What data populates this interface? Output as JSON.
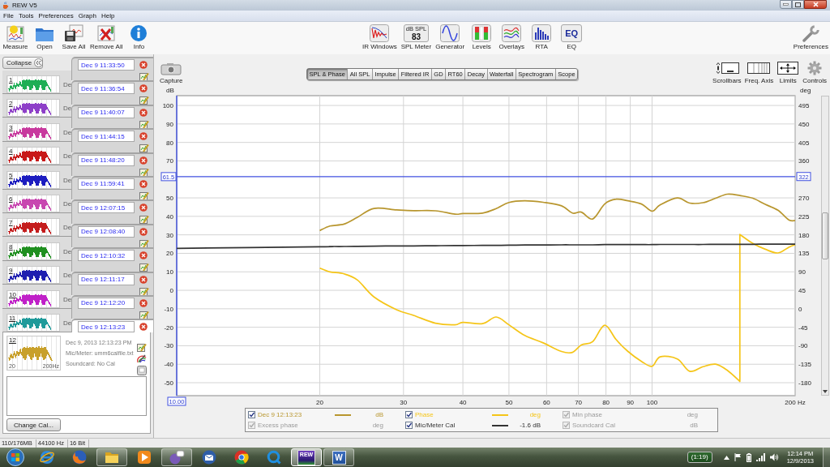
{
  "window": {
    "title": "REW V5"
  },
  "menu": [
    "File",
    "Tools",
    "Preferences",
    "Graph",
    "Help"
  ],
  "toolbar": {
    "left": [
      {
        "label": "Measure",
        "kind": "measure"
      },
      {
        "label": "Open",
        "kind": "open"
      },
      {
        "label": "Save All",
        "kind": "save"
      },
      {
        "label": "Remove All",
        "kind": "remove"
      },
      {
        "label": "Info",
        "kind": "info"
      }
    ],
    "center": [
      {
        "label": "IR Windows",
        "kind": "ir"
      },
      {
        "label": "SPL Meter",
        "kind": "spl",
        "icon_text": [
          "dB SPL",
          "83"
        ]
      },
      {
        "label": "Generator",
        "kind": "generator"
      },
      {
        "label": "Levels",
        "kind": "levels"
      },
      {
        "label": "Overlays",
        "kind": "overlays"
      },
      {
        "label": "RTA",
        "kind": "rta"
      },
      {
        "label": "EQ",
        "kind": "eq",
        "icon_text": [
          "EQ"
        ]
      }
    ],
    "right": [
      {
        "label": "Preferences",
        "kind": "wrench"
      }
    ]
  },
  "sidebar": {
    "collapse": "Collapse",
    "measurements": [
      {
        "number": "1",
        "title": "Dec 9 11:33:50",
        "color": "#1fae55",
        "selected": false,
        "info": "De"
      },
      {
        "number": "2",
        "title": "Dec 9 11:36:54",
        "color": "#8e3fc8",
        "selected": false,
        "info": "De"
      },
      {
        "number": "3",
        "title": "Dec 9 11:40:07",
        "color": "#c8399e",
        "selected": false,
        "info": "De"
      },
      {
        "number": "4",
        "title": "Dec 9 11:44:15",
        "color": "#c81818",
        "selected": false,
        "info": "De"
      },
      {
        "number": "5",
        "title": "Dec 9 11:48:20",
        "color": "#1c1cc0",
        "selected": false,
        "info": "De"
      },
      {
        "number": "6",
        "title": "Dec 9 11:59:41",
        "color": "#c846b0",
        "selected": false,
        "info": "De"
      },
      {
        "number": "7",
        "title": "Dec 9 12:07:15",
        "color": "#c41c1c",
        "selected": false,
        "info": "De"
      },
      {
        "number": "8",
        "title": "Dec 9 12:08:40",
        "color": "#1f8f1f",
        "selected": false,
        "info": "De"
      },
      {
        "number": "9",
        "title": "Dec 9 12:10:32",
        "color": "#1f1fb0",
        "selected": false,
        "info": "De"
      },
      {
        "number": "10",
        "title": "Dec 9 12:11:17",
        "color": "#c020c8",
        "selected": false,
        "info": "De"
      },
      {
        "number": "11",
        "title": "Dec 9 12:12:20",
        "color": "#1f9a9a",
        "selected": false,
        "info": "De"
      },
      {
        "number": "12",
        "title": "Dec 9 12:13:23",
        "color": "#c8a02a",
        "selected": true,
        "info_lines": [
          "Dec 9, 2013 12:13:23 PM",
          "Mic/Meter: umm6calfile.txt",
          "Soundcard: No Cal"
        ],
        "axis_labels": [
          "20",
          "200Hz"
        ]
      }
    ],
    "change_cal": "Change Cal..."
  },
  "graph": {
    "capture": "Capture",
    "tabs": [
      {
        "label": "SPL & Phase",
        "selected": true
      },
      {
        "label": "All SPL",
        "selected": false
      },
      {
        "label": "Impulse",
        "selected": false
      },
      {
        "label": "Filtered IR",
        "selected": false
      },
      {
        "label": "GD",
        "selected": false
      },
      {
        "label": "RT60",
        "selected": false
      },
      {
        "label": "Decay",
        "selected": false
      },
      {
        "label": "Waterfall",
        "selected": false
      },
      {
        "label": "Spectrogram",
        "selected": false
      },
      {
        "label": "Scope",
        "selected": false
      }
    ],
    "tools": [
      {
        "label": "Scrollbars",
        "kind": "scrollbars"
      },
      {
        "label": "Freq. Axis",
        "kind": "freq"
      },
      {
        "label": "Limits",
        "kind": "limits"
      },
      {
        "label": "Controls",
        "kind": "controls"
      }
    ],
    "chart_data": {
      "type": "line",
      "ylabel": "dB",
      "y2label": "deg",
      "log": "x",
      "grid": true,
      "xlim": [
        10,
        200
      ],
      "ylim": [
        -57,
        105.3
      ],
      "y2lim": [
        -211.5,
        518.85
      ],
      "xticks": [
        {
          "value": 10,
          "label": "10.00"
        },
        20,
        30,
        40,
        50,
        60,
        70,
        80,
        90,
        100,
        {
          "value": 200,
          "label": "200 Hz"
        }
      ],
      "yticks": [
        100,
        90,
        80,
        70,
        50,
        40,
        30,
        20,
        10,
        0,
        -10,
        -20,
        -30,
        -40,
        -50
      ],
      "y2ticks": [
        495,
        450,
        405,
        360,
        {
          "value": 322,
          "label": "322"
        },
        270,
        225,
        180,
        135,
        90,
        45,
        0,
        -45,
        -90,
        -135,
        -180
      ],
      "x": [
        10,
        20,
        21,
        22.5,
        24,
        26,
        29,
        31.5,
        35,
        38.5,
        40,
        44,
        47,
        50,
        54,
        59,
        64.5,
        68,
        71,
        75,
        79.5,
        84,
        89,
        95,
        100,
        104,
        113,
        120,
        128,
        136,
        144,
        153,
        153,
        163,
        173,
        184,
        194,
        200
      ],
      "series": [
        {
          "name": "Dec 9 12:13:23",
          "color": "#b8962e",
          "values": [
            null,
            32.3,
            34.8,
            35.8,
            39.5,
            44.3,
            43.5,
            43.1,
            43.0,
            41.2,
            41.5,
            41.8,
            44.2,
            47.5,
            48.4,
            47.6,
            45.7,
            41.8,
            42.3,
            38.6,
            46.7,
            49.3,
            48.4,
            46.7,
            42.8,
            46.2,
            50.0,
            47.2,
            47.4,
            49.8,
            52.0,
            51.3,
            51.3,
            49.8,
            46.5,
            43.3,
            38.1,
            37.7
          ]
        },
        {
          "name": "Phase",
          "color": "#f5c518",
          "axis": "y2",
          "values": [
            null,
            99,
            90,
            85,
            70,
            29,
            -2,
            -16,
            -35,
            -39,
            -33,
            -36,
            -20,
            -39,
            -65,
            -83,
            -104,
            -106,
            -88,
            -80,
            -40,
            -75,
            -104,
            -128,
            -140,
            -117,
            -122,
            -152,
            -141,
            -135,
            -150,
            -177,
            181,
            159,
            145,
            136,
            150,
            156
          ]
        },
        {
          "name": "Mic/Meter Cal",
          "color": "#333333",
          "values": [
            22.7,
            23.6,
            23.7,
            23.7,
            23.8,
            23.9,
            24.0,
            24.0,
            24.1,
            24.2,
            24.2,
            24.3,
            24.3,
            24.4,
            24.5,
            24.5,
            24.6,
            24.6,
            24.6,
            24.6,
            24.7,
            24.7,
            24.7,
            24.7,
            24.7,
            24.8,
            24.8,
            24.8,
            24.8,
            24.9,
            24.9,
            24.9,
            24.9,
            24.9,
            25.0,
            25.0,
            25.0,
            25.0
          ]
        }
      ],
      "ref_lines": [
        {
          "axis": "y",
          "value": 61.5,
          "label": "61.5"
        }
      ]
    },
    "legend": [
      {
        "kind": "series",
        "checked": true,
        "disabled": false,
        "reading": "dB"
      },
      {
        "kind": "series",
        "checked": true,
        "disabled": false,
        "reading": "deg"
      },
      {
        "kind": "trace",
        "label": "Min phase",
        "checked": true,
        "disabled": true,
        "reading": "deg"
      },
      {
        "kind": "trace",
        "label": "Excess phase",
        "checked": true,
        "disabled": true,
        "reading": "deg"
      },
      {
        "kind": "series",
        "checked": true,
        "disabled": false,
        "reading": "-1.6 dB"
      },
      {
        "kind": "trace",
        "label": "Soundcard Cal",
        "checked": true,
        "disabled": true,
        "reading": "dB"
      }
    ]
  },
  "status_bar": [
    "110/176MB",
    "44100 Hz",
    "16 Bit"
  ],
  "taskbar": {
    "apps": [
      {
        "kind": "ie",
        "running": false,
        "selected": false
      },
      {
        "kind": "firefox",
        "running": false,
        "selected": false
      },
      {
        "kind": "explorer",
        "running": true,
        "selected": false
      },
      {
        "kind": "mediaplayer",
        "running": false,
        "selected": false
      },
      {
        "kind": "pidgin",
        "running": true,
        "selected": false
      },
      {
        "kind": "thunderbird",
        "running": false,
        "selected": false
      },
      {
        "kind": "chrome",
        "running": false,
        "selected": false
      },
      {
        "kind": "quicktime",
        "running": false,
        "selected": false
      },
      {
        "kind": "rew",
        "running": true,
        "selected": true,
        "icon_text": "REW"
      },
      {
        "kind": "word",
        "running": true,
        "selected": false,
        "icon_text": "W"
      }
    ],
    "battery": "(1:19)",
    "time": "12:14 PM",
    "date": "12/9/2013"
  }
}
